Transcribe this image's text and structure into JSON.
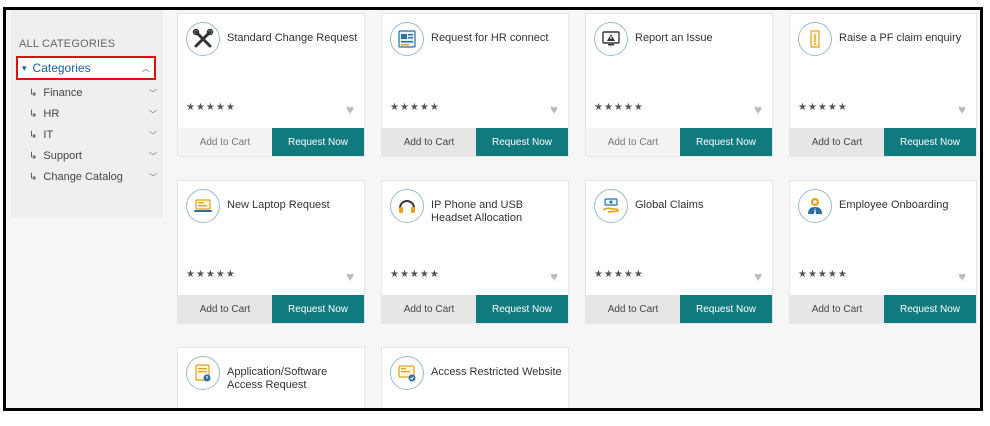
{
  "sidebar": {
    "header": "ALL CATEGORIES",
    "root": {
      "label": "Categories"
    },
    "items": [
      {
        "label": "Finance"
      },
      {
        "label": "HR"
      },
      {
        "label": "IT"
      },
      {
        "label": "Support"
      },
      {
        "label": "Change Catalog"
      }
    ]
  },
  "cards": [
    {
      "title": "Standard Change Request",
      "icon": "tools-icon",
      "rating": "★★★★★",
      "add_label": "Add to Cart",
      "request_label": "Request Now"
    },
    {
      "title": "Request for HR connect",
      "icon": "hr-connect-icon",
      "rating": "★★★★★",
      "add_label": "Add to Cart",
      "request_label": "Request Now"
    },
    {
      "title": "Report an Issue",
      "icon": "alert-monitor-icon",
      "rating": "★★★★★",
      "add_label": "Add to Cart",
      "request_label": "Request Now"
    },
    {
      "title": "Raise a PF claim enquiry",
      "icon": "pf-claim-icon",
      "rating": "★★★★★",
      "add_label": "Add to Cart",
      "request_label": "Request Now"
    },
    {
      "title": "New Laptop Request",
      "icon": "laptop-icon",
      "rating": "★★★★★",
      "add_label": "Add to Cart",
      "request_label": "Request Now"
    },
    {
      "title": "IP Phone and USB Headset Allocation",
      "icon": "headset-icon",
      "rating": "★★★★★",
      "add_label": "Add to Cart",
      "request_label": "Request Now"
    },
    {
      "title": "Global Claims",
      "icon": "claims-hand-icon",
      "rating": "★★★★★",
      "add_label": "Add to Cart",
      "request_label": "Request Now"
    },
    {
      "title": "Employee Onboarding",
      "icon": "employee-icon",
      "rating": "★★★★★",
      "add_label": "Add to Cart",
      "request_label": "Request Now"
    },
    {
      "title": "Application/Software Access Request",
      "icon": "software-access-icon"
    },
    {
      "title": "Access Restricted Website",
      "icon": "restricted-website-icon"
    }
  ],
  "colors": {
    "accent": "#117a7f",
    "highlight": "#dd1111",
    "link": "#1a5f9e"
  }
}
